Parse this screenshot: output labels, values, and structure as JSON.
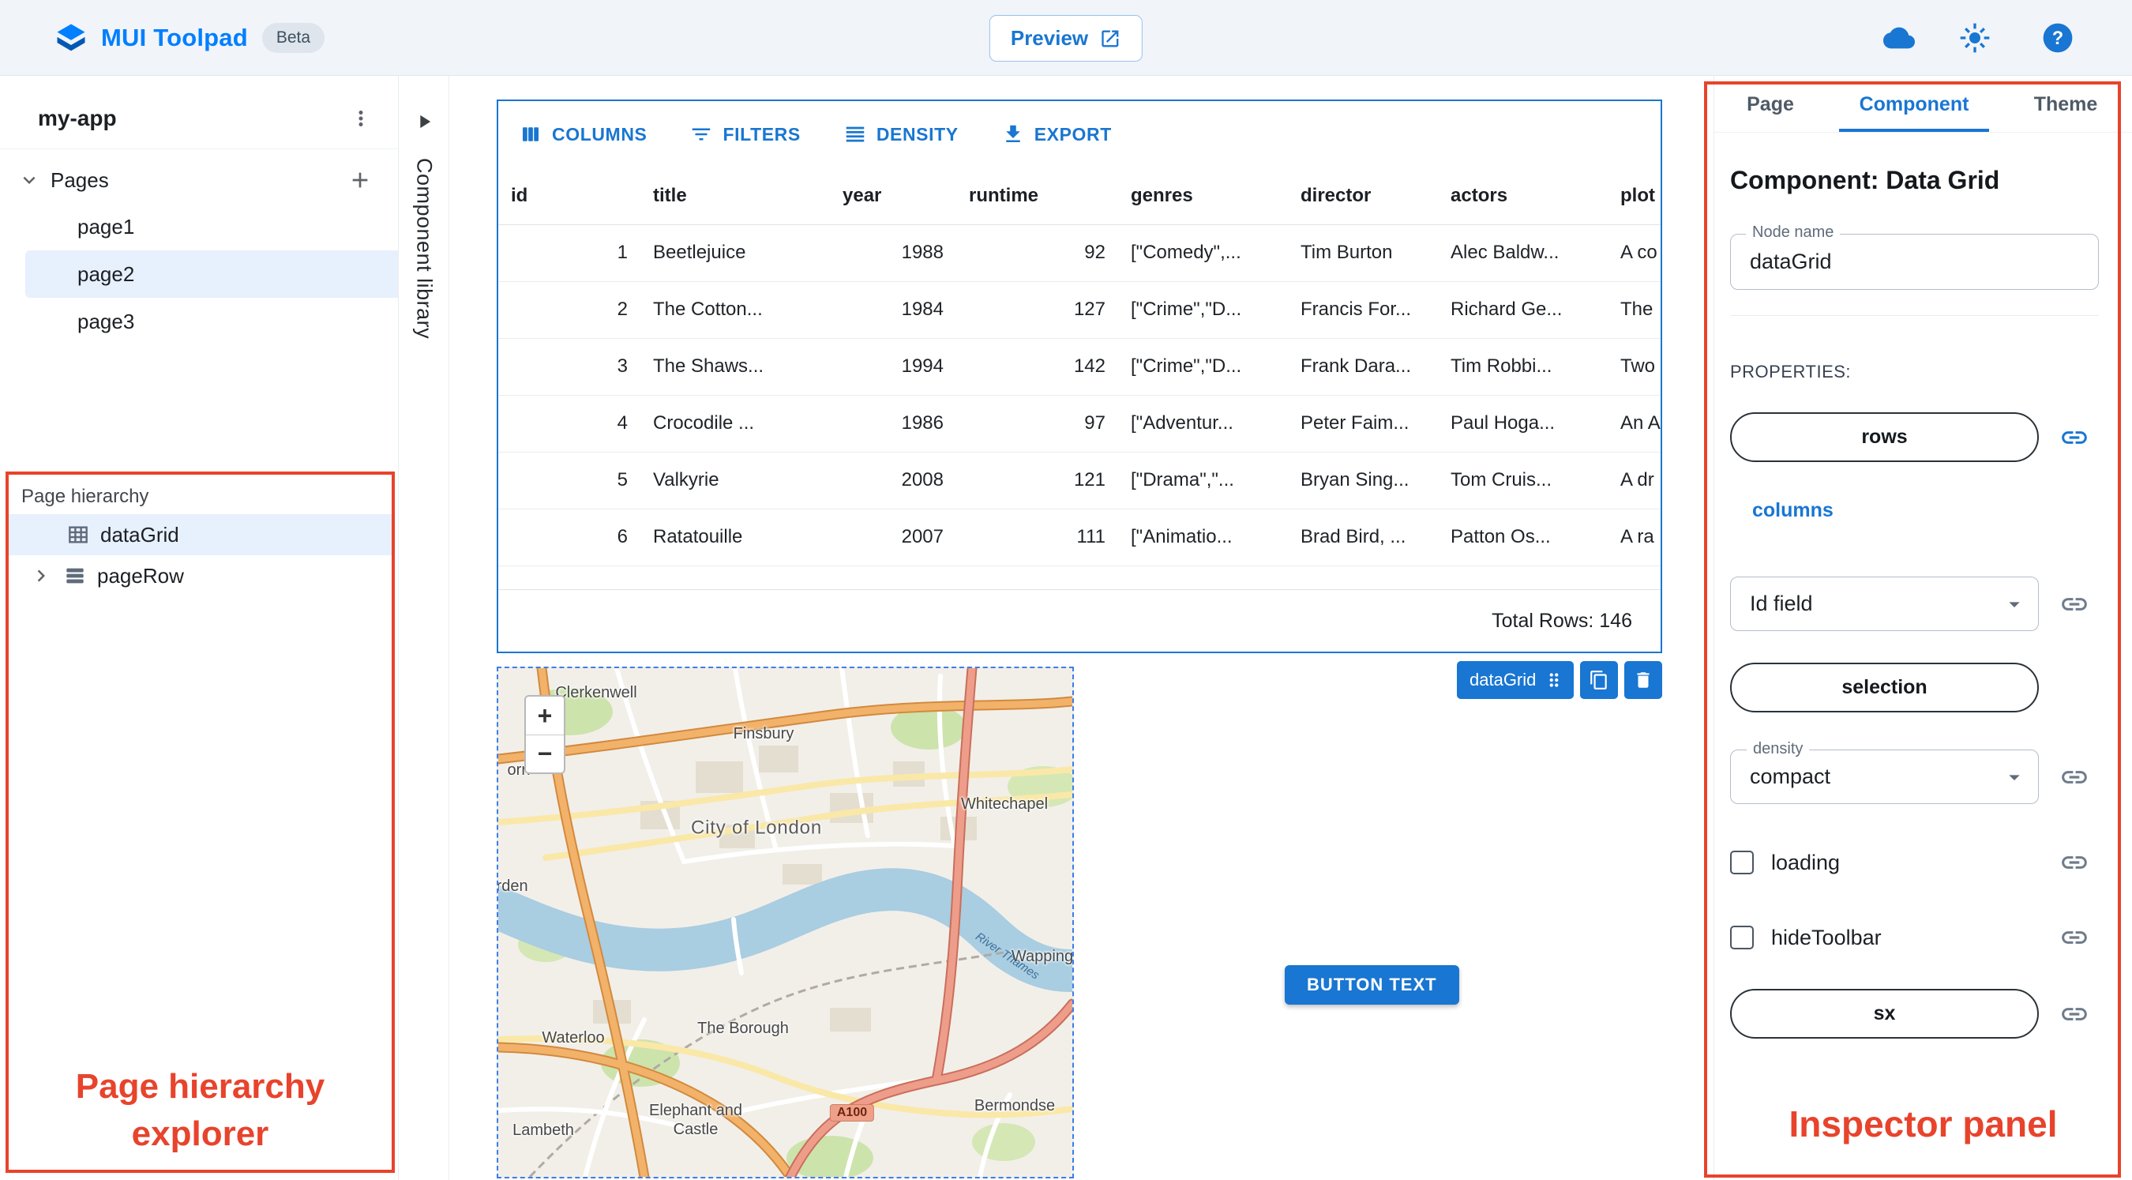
{
  "app_bar": {
    "title": "MUI Toolpad",
    "badge": "Beta",
    "preview_label": "Preview",
    "help_glyph": "?"
  },
  "explorer": {
    "app_name": "my-app",
    "pages_label": "Pages",
    "pages": [
      {
        "label": "page1",
        "selected": false
      },
      {
        "label": "page2",
        "selected": true
      },
      {
        "label": "page3",
        "selected": false
      }
    ]
  },
  "hierarchy": {
    "title": "Page hierarchy",
    "items": [
      {
        "label": "dataGrid",
        "selected": true
      },
      {
        "label": "pageRow",
        "selected": false
      }
    ],
    "annotation": "Page hierarchy explorer"
  },
  "component_library": {
    "label": "Component library"
  },
  "canvas": {
    "datagrid": {
      "toolbar": [
        {
          "label": "COLUMNS"
        },
        {
          "label": "FILTERS"
        },
        {
          "label": "DENSITY"
        },
        {
          "label": "EXPORT"
        }
      ],
      "columns": [
        {
          "label": "id"
        },
        {
          "label": "title"
        },
        {
          "label": "year"
        },
        {
          "label": "runtime"
        },
        {
          "label": "genres"
        },
        {
          "label": "director"
        },
        {
          "label": "actors"
        },
        {
          "label": "plot"
        }
      ],
      "rows": [
        [
          "1",
          "Beetlejuice",
          "1988",
          "92",
          "[\"Comedy\",...",
          "Tim Burton",
          "Alec Baldw...",
          "A co"
        ],
        [
          "2",
          "The Cotton...",
          "1984",
          "127",
          "[\"Crime\",\"D...",
          "Francis For...",
          "Richard Ge...",
          "The"
        ],
        [
          "3",
          "The Shaws...",
          "1994",
          "142",
          "[\"Crime\",\"D...",
          "Frank Dara...",
          "Tim Robbi...",
          "Two"
        ],
        [
          "4",
          "Crocodile ...",
          "1986",
          "97",
          "[\"Adventur...",
          "Peter Faim...",
          "Paul Hoga...",
          "An A"
        ],
        [
          "5",
          "Valkyrie",
          "2008",
          "121",
          "[\"Drama\",\"...",
          "Bryan Sing...",
          "Tom Cruis...",
          "A dr"
        ],
        [
          "6",
          "Ratatouille",
          "2007",
          "111",
          "[\"Animatio...",
          "Brad Bird, ...",
          "Patton Os...",
          "A ra"
        ]
      ],
      "footer": "Total Rows: 146",
      "selection": {
        "label": "dataGrid"
      }
    },
    "map": {
      "zoom_in": "+",
      "zoom_out": "−",
      "labels": [
        {
          "text": "Clerkenwell"
        },
        {
          "text": "orn"
        },
        {
          "text": "Finsbury"
        },
        {
          "text": "Whitechapel"
        },
        {
          "text": "City of London"
        },
        {
          "text": "arden"
        },
        {
          "text": "Wapping"
        },
        {
          "text": "Waterloo"
        },
        {
          "text": "The Borough"
        },
        {
          "text": "Bermondse"
        },
        {
          "text": "Elephant and\nCastle"
        },
        {
          "text": "Lambeth"
        }
      ],
      "road_badge": "A100",
      "river_label": "River Thames"
    },
    "button": {
      "label": "BUTTON TEXT"
    }
  },
  "inspector": {
    "tabs": [
      {
        "label": "Page",
        "active": false
      },
      {
        "label": "Component",
        "active": true
      },
      {
        "label": "Theme",
        "active": false
      }
    ],
    "heading": "Component: Data Grid",
    "node_name": {
      "label": "Node name",
      "value": "dataGrid"
    },
    "properties_label": "PROPERTIES:",
    "rows_prop": {
      "label": "rows",
      "bound": true
    },
    "columns_prop": {
      "label": "columns"
    },
    "id_field": {
      "value": "Id field"
    },
    "selection_prop": {
      "label": "selection"
    },
    "density": {
      "label": "density",
      "value": "compact"
    },
    "loading": {
      "label": "loading",
      "checked": false
    },
    "hide_toolbar": {
      "label": "hideToolbar",
      "checked": false
    },
    "sx": {
      "label": "sx"
    },
    "annotation": "Inspector panel"
  },
  "icons": {
    "logo": "stacked-layers",
    "preview": "open-in-new",
    "cloud": "cloud",
    "theme_toggle": "sun",
    "help": "question-circle",
    "menu": "kebab-vertical",
    "add_page": "plus",
    "expand": "chevron-down",
    "collapse": "chevron-right",
    "columns": "view-columns",
    "filters": "filter-lines",
    "density": "density-lines",
    "export": "download",
    "binding": "link-chain",
    "drag": "drag-dots",
    "duplicate": "copy",
    "delete": "trash",
    "datagrid_node": "grid",
    "pagerow_node": "rows",
    "dropdown": "caret-down"
  },
  "colors": {
    "accent": "#1976d2",
    "brand": "#007fff",
    "annotation": "#e8432c",
    "selected_bg": "#e7f0fd"
  }
}
